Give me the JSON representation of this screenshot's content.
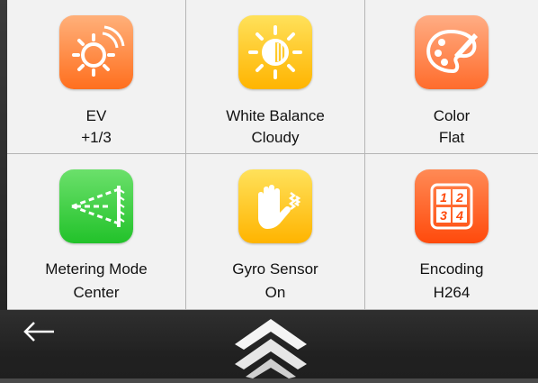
{
  "tiles": [
    {
      "line1": "EV",
      "line2": "+1/3",
      "icon": "ev-sun-icon"
    },
    {
      "line1": "White Balance",
      "line2": "Cloudy",
      "icon": "white-balance-icon"
    },
    {
      "line1": "Color",
      "line2": "Flat",
      "icon": "color-palette-icon"
    },
    {
      "line1": "Metering Mode",
      "line2": "Center",
      "icon": "metering-icon"
    },
    {
      "line1": "Gyro Sensor",
      "line2": "On",
      "icon": "gyro-hand-icon"
    },
    {
      "line1": "Encoding",
      "line2": "H264",
      "icon": "encoding-grid-icon"
    }
  ],
  "encoding_icon_numbers": [
    "1",
    "2",
    "3",
    "4"
  ],
  "nav": {
    "back_icon": "back-arrow-icon",
    "up_icon": "chevron-up-icon"
  },
  "colors": {
    "orange": "#ff7a2e",
    "yellow": "#ffc20e",
    "green": "#2fc635",
    "red": "#ff5a1a"
  }
}
